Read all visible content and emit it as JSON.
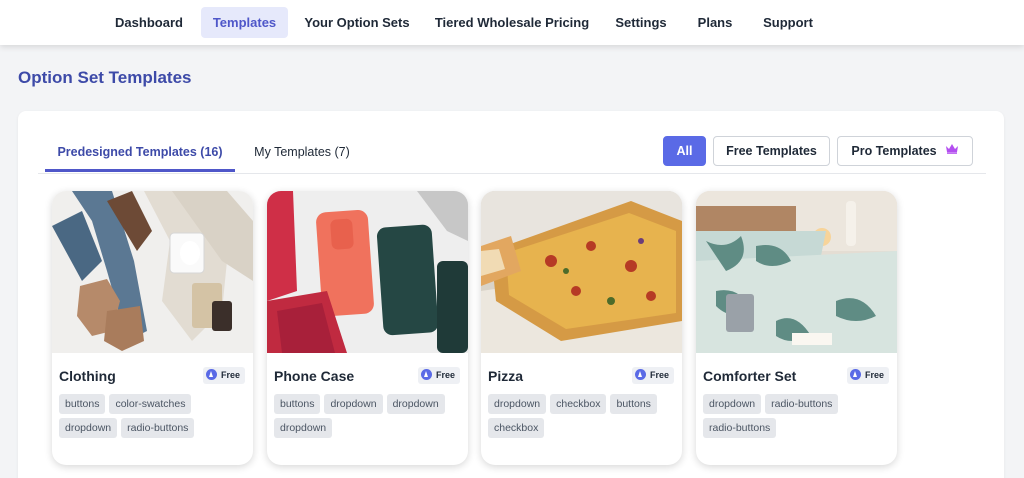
{
  "nav": {
    "items": [
      {
        "label": "Dashboard",
        "active": false
      },
      {
        "label": "Templates",
        "active": true
      },
      {
        "label": "Your Option Sets",
        "active": false
      },
      {
        "label": "Tiered Wholesale Pricing",
        "active": false
      },
      {
        "label": "Settings",
        "active": false
      },
      {
        "label": "Plans",
        "active": false
      },
      {
        "label": "Support",
        "active": false
      }
    ]
  },
  "page": {
    "title": "Option Set Templates"
  },
  "tabs": [
    {
      "label": "Predesigned Templates (16)",
      "active": true
    },
    {
      "label": "My Templates (7)",
      "active": false
    }
  ],
  "filters": [
    {
      "label": "All",
      "active": true
    },
    {
      "label": "Free Templates",
      "active": false
    },
    {
      "label": "Pro Templates",
      "active": false,
      "icon": "crown-icon"
    }
  ],
  "colors": {
    "accent": "#5a6ae6",
    "title": "#3d4aa8",
    "crown": "#b34ef0"
  },
  "templates": [
    {
      "name": "Clothing",
      "badge": "Free",
      "tags": [
        "buttons",
        "color-swatches",
        "dropdown",
        "radio-buttons"
      ]
    },
    {
      "name": "Phone Case",
      "badge": "Free",
      "tags": [
        "buttons",
        "dropdown",
        "dropdown",
        "dropdown"
      ]
    },
    {
      "name": "Pizza",
      "badge": "Free",
      "tags": [
        "dropdown",
        "checkbox",
        "buttons",
        "checkbox"
      ]
    },
    {
      "name": "Comforter Set",
      "badge": "Free",
      "tags": [
        "dropdown",
        "radio-buttons",
        "radio-buttons"
      ]
    }
  ]
}
